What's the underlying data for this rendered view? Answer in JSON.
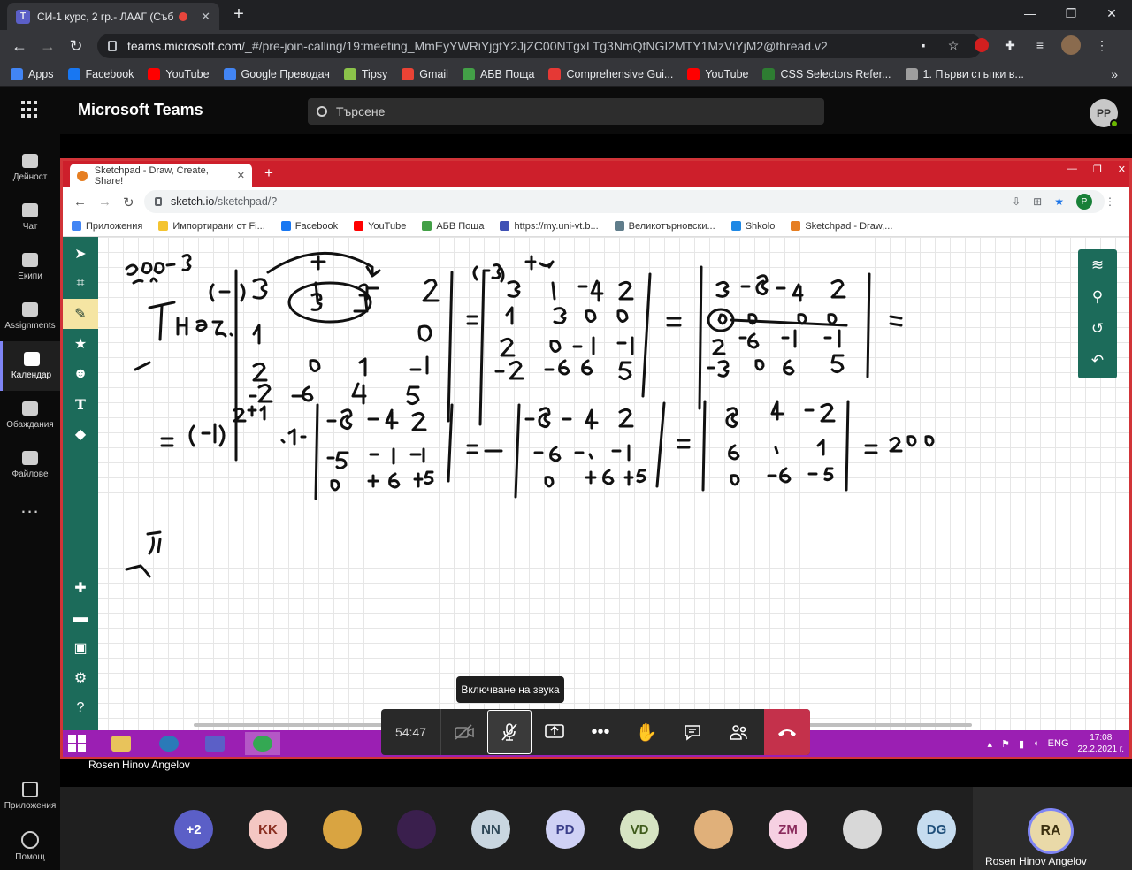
{
  "outer_browser": {
    "tab_title": "СИ-1 курс, 2 гр.- ЛААГ (Съб",
    "url_host": "teams.microsoft.com",
    "url_path": "/_#/pre-join-calling/19:meeting_MmEyYWRiYjgtY2JjZC00NTgxLTg3NmQtNGI2MTY1MzViYjM2@thread.v2",
    "bookmarks": [
      {
        "label": "Apps",
        "color": "#4285f4"
      },
      {
        "label": "Facebook",
        "color": "#1877f2"
      },
      {
        "label": "YouTube",
        "color": "#ff0000"
      },
      {
        "label": "Google Преводач",
        "color": "#4285f4"
      },
      {
        "label": "Tipsy",
        "color": "#8bc34a"
      },
      {
        "label": "Gmail",
        "color": "#ea4335"
      },
      {
        "label": "АБВ Поща",
        "color": "#43a047"
      },
      {
        "label": "Comprehensive Gui...",
        "color": "#e53935"
      },
      {
        "label": "YouTube",
        "color": "#ff0000"
      },
      {
        "label": "CSS Selectors Refer...",
        "color": "#2e7d32"
      },
      {
        "label": "1. Първи стъпки в...",
        "color": "#9e9e9e"
      }
    ]
  },
  "teams": {
    "app_title": "Microsoft Teams",
    "search_placeholder": "Търсене",
    "me_initials": "PP",
    "rail": [
      {
        "label": "Дейност",
        "icon": "bell-icon"
      },
      {
        "label": "Чат",
        "icon": "chat-icon"
      },
      {
        "label": "Екипи",
        "icon": "teams-icon"
      },
      {
        "label": "Assignments",
        "icon": "assignments-icon"
      },
      {
        "label": "Календар",
        "icon": "calendar-icon"
      },
      {
        "label": "Обаждания",
        "icon": "phone-icon"
      },
      {
        "label": "Файлове",
        "icon": "files-icon"
      }
    ],
    "rail_more": "...",
    "rail_apps": "Приложения",
    "rail_help": "Помощ",
    "presenter_name": "Rosen Hinov Angelov"
  },
  "shared_browser": {
    "tab_title": "Sketchpad - Draw, Create, Share!",
    "url_host": "sketch.io",
    "url_path": "/sketchpad/?",
    "profile_initial": "P",
    "bookmarks": [
      {
        "label": "Приложения",
        "color": "#4285f4"
      },
      {
        "label": "Импортирани от Fi...",
        "color": "#f4c430"
      },
      {
        "label": "Facebook",
        "color": "#1877f2"
      },
      {
        "label": "YouTube",
        "color": "#ff0000"
      },
      {
        "label": "АБВ Поща",
        "color": "#43a047"
      },
      {
        "label": "https://my.uni-vt.b...",
        "color": "#3f51b5"
      },
      {
        "label": "Великотърновски...",
        "color": "#607d8b"
      },
      {
        "label": "Shkolo",
        "color": "#1e88e5"
      },
      {
        "label": "Sketchpad - Draw,...",
        "color": "#e67e22"
      }
    ],
    "taskbar": {
      "lang": "ENG",
      "time": "17:08",
      "date": "22.2.2021 г."
    }
  },
  "meeting": {
    "tooltip": "Включване на звука",
    "timer": "54:47"
  },
  "participants": [
    {
      "label": "+2",
      "bg": "#5b5fc7",
      "fg": "#ffffff"
    },
    {
      "label": "KK",
      "bg": "#f4c7c3",
      "fg": "#8a2e20"
    },
    {
      "label": "",
      "bg": "#d9a441",
      "fg": "#ffffff"
    },
    {
      "label": "",
      "bg": "#3a1f4d",
      "fg": "#ffffff"
    },
    {
      "label": "NN",
      "bg": "#c9d6e0",
      "fg": "#2f4858"
    },
    {
      "label": "PD",
      "bg": "#cfd1f5",
      "fg": "#3b3f8a"
    },
    {
      "label": "VD",
      "bg": "#d6e4c3",
      "fg": "#3f5b1c"
    },
    {
      "label": "",
      "bg": "#e0b07a",
      "fg": "#ffffff"
    },
    {
      "label": "ZM",
      "bg": "#f6d0e2",
      "fg": "#8a2a5c"
    },
    {
      "label": "",
      "bg": "#d8d8d8",
      "fg": "#ffffff"
    },
    {
      "label": "DG",
      "bg": "#c6dcef",
      "fg": "#1f4f7a"
    }
  ],
  "self": {
    "initials": "RA",
    "name": "Rosen Hinov Angelov"
  }
}
